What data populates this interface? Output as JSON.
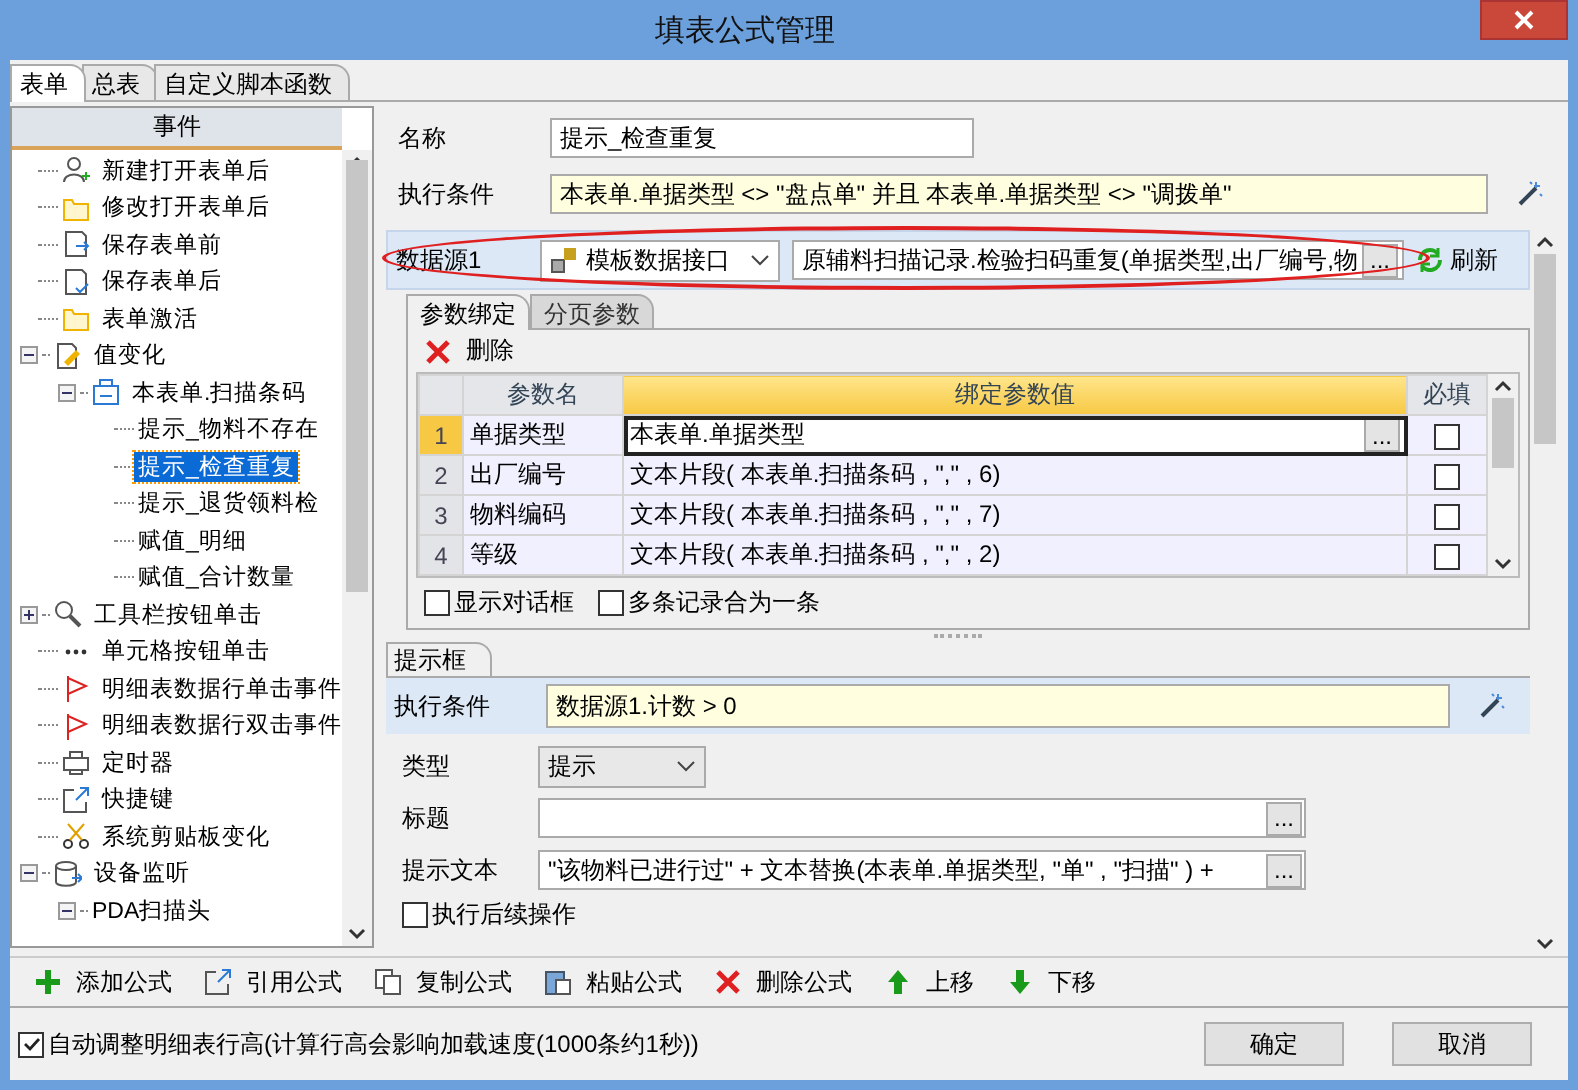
{
  "window": {
    "title": "填表公式管理"
  },
  "tabs": [
    {
      "label": "表单",
      "selected": true
    },
    {
      "label": "总表",
      "selected": false
    },
    {
      "label": "自定义脚本函数",
      "selected": false
    }
  ],
  "events_panel": {
    "header": "事件",
    "tree": [
      {
        "label": "新建打开表单后",
        "kind": "user",
        "selected": false
      },
      {
        "label": "修改打开表单后",
        "kind": "folder",
        "selected": false
      },
      {
        "label": "保存表单前",
        "kind": "save",
        "selected": false
      },
      {
        "label": "保存表单后",
        "kind": "saved",
        "selected": false
      },
      {
        "label": "表单激活",
        "kind": "folder",
        "selected": false
      },
      {
        "label": "值变化",
        "kind": "edit",
        "selected": false,
        "expanded": true,
        "children": [
          {
            "label": "本表单.扫描条码",
            "kind": "field",
            "selected": false,
            "expanded": true,
            "children": [
              {
                "label": "提示_物料不存在",
                "selected": false
              },
              {
                "label": "提示_检查重复",
                "selected": true
              },
              {
                "label": "提示_退货领料检",
                "selected": false
              },
              {
                "label": "赋值_明细",
                "selected": false
              },
              {
                "label": "赋值_合计数量",
                "selected": false
              }
            ]
          }
        ]
      },
      {
        "label": "工具栏按钮单击",
        "kind": "tool",
        "selected": false,
        "expanded": false
      },
      {
        "label": "单元格按钮单击",
        "kind": "dots",
        "selected": false
      },
      {
        "label": "明细表数据行单击事件",
        "kind": "flag",
        "selected": false
      },
      {
        "label": "明细表数据行双击事件",
        "kind": "flag",
        "selected": false
      },
      {
        "label": "定时器",
        "kind": "printer",
        "selected": false
      },
      {
        "label": "快捷键",
        "kind": "link",
        "selected": false
      },
      {
        "label": "系统剪贴板变化",
        "kind": "scissors",
        "selected": false
      },
      {
        "label": "设备监听",
        "kind": "device",
        "selected": false,
        "expanded": true,
        "children": [
          {
            "label": "PDA扫描头",
            "selected": false,
            "expanded": true
          }
        ]
      }
    ]
  },
  "formula": {
    "name_label": "名称",
    "name": "提示_检查重复",
    "condition_label": "执行条件",
    "condition": "本表单.单据类型  <>  \"盘点单\" 并且  本表单.单据类型  <>  \"调拨单\"",
    "data_source": {
      "label": "数据源1",
      "type": "模板数据接口",
      "value": "原辅料扫描记录.检验扫码重复(单据类型,出厂编号,物",
      "button": "...",
      "refresh": "刷新"
    },
    "param_tabs": [
      {
        "label": "参数绑定",
        "selected": true
      },
      {
        "label": "分页参数",
        "selected": false
      }
    ],
    "delete": "删除",
    "grid": {
      "columns": [
        "参数名",
        "绑定参数值",
        "必填"
      ],
      "rows": [
        {
          "index": "1",
          "name": "单据类型",
          "value": "本表单.单据类型",
          "required": false,
          "selected": true,
          "button": "..."
        },
        {
          "index": "2",
          "name": "出厂编号",
          "value": "文本片段( 本表单.扫描条码 , \",\"  , 6)",
          "required": false,
          "selected": false
        },
        {
          "index": "3",
          "name": "物料编码",
          "value": "文本片段( 本表单.扫描条码 ,  \",\"   , 7)",
          "required": false,
          "selected": false
        },
        {
          "index": "4",
          "name": "等级",
          "value": "文本片段( 本表单.扫描条码 ,  \",\" , 2)",
          "required": false,
          "selected": false
        }
      ]
    },
    "options": [
      {
        "label": "显示对话框",
        "checked": false
      },
      {
        "label": "多条记录合为一条",
        "checked": false
      }
    ]
  },
  "prompt": {
    "tab": "提示框",
    "condition_label": "执行条件",
    "condition": "数据源1.计数  > 0",
    "type_label": "类型",
    "type": "提示",
    "title_label": "标题",
    "title_button": "...",
    "text_label": "提示文本",
    "text": "\"该物料已进行过\"  +  文本替换(本表单.单据类型, \"单\" , \"扫描\" )  +",
    "text_button": "...",
    "follow_up": {
      "label": "执行后续操作",
      "checked": false
    }
  },
  "toolbar": [
    {
      "label": "添加公式",
      "kind": "add"
    },
    {
      "label": "引用公式",
      "kind": "link"
    },
    {
      "label": "复制公式",
      "kind": "copy"
    },
    {
      "label": "粘贴公式",
      "kind": "paste"
    },
    {
      "label": "删除公式",
      "kind": "delete"
    },
    {
      "label": "上移",
      "kind": "up"
    },
    {
      "label": "下移",
      "kind": "down"
    }
  ],
  "footer": {
    "auto_height": {
      "label": "自动调整明细表行高(计算行高会影响加载速度(1000条约1秒))",
      "checked": true
    },
    "buttons": [
      "确定",
      "取消"
    ]
  }
}
